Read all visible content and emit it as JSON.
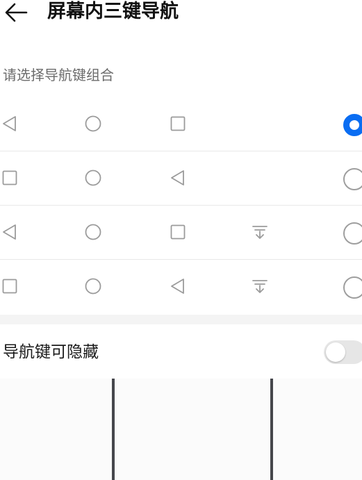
{
  "header": {
    "title": "屏幕内三键导航",
    "back_icon": "arrow-left-icon"
  },
  "section": {
    "label": "请选择导航键组合"
  },
  "options": [
    {
      "icons": [
        "back-triangle-icon",
        "home-circle-icon",
        "recents-square-icon"
      ],
      "selected": true
    },
    {
      "icons": [
        "recents-square-icon",
        "home-circle-icon",
        "back-triangle-icon"
      ],
      "selected": false
    },
    {
      "icons": [
        "back-triangle-icon",
        "home-circle-icon",
        "recents-square-icon",
        "notification-pulldown-icon"
      ],
      "selected": false
    },
    {
      "icons": [
        "recents-square-icon",
        "home-circle-icon",
        "back-triangle-icon",
        "notification-pulldown-icon"
      ],
      "selected": false
    }
  ],
  "hide_nav": {
    "label": "导航键可隐藏",
    "enabled": false
  },
  "colors": {
    "accent": "#0a6df2",
    "icon_gray": "#9b9b9b",
    "divider": "#e8e8e8"
  }
}
